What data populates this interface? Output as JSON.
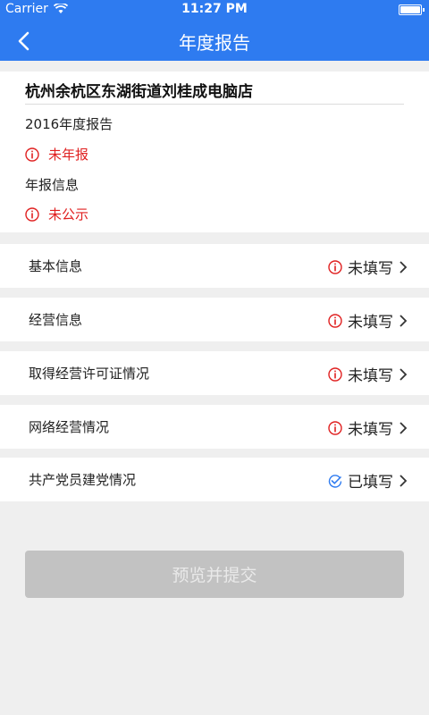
{
  "status_bar": {
    "carrier": "Carrier",
    "time": "11:27 PM"
  },
  "nav": {
    "title": "年度报告"
  },
  "info": {
    "company": "杭州余杭区东湖街道刘桂成电脑店",
    "report_year": "2016年度报告",
    "report_status": "未年报",
    "info_label": "年报信息",
    "publish_status": "未公示"
  },
  "sections": [
    {
      "label": "基本信息",
      "status": "未填写",
      "icon": "alert-icon"
    },
    {
      "label": "经营信息",
      "status": "未填写",
      "icon": "alert-icon"
    },
    {
      "label": "取得经营许可证情况",
      "status": "未填写",
      "icon": "alert-icon"
    },
    {
      "label": "网络经营情况",
      "status": "未填写",
      "icon": "alert-icon"
    },
    {
      "label": "共产党员建党情况",
      "status": "已填写",
      "icon": "check-icon"
    }
  ],
  "submit_label": "预览并提交",
  "colors": {
    "primary": "#2e7bf0",
    "alert": "#e02020",
    "done": "#2e7bf0",
    "disabled": "#c2c2c2"
  }
}
